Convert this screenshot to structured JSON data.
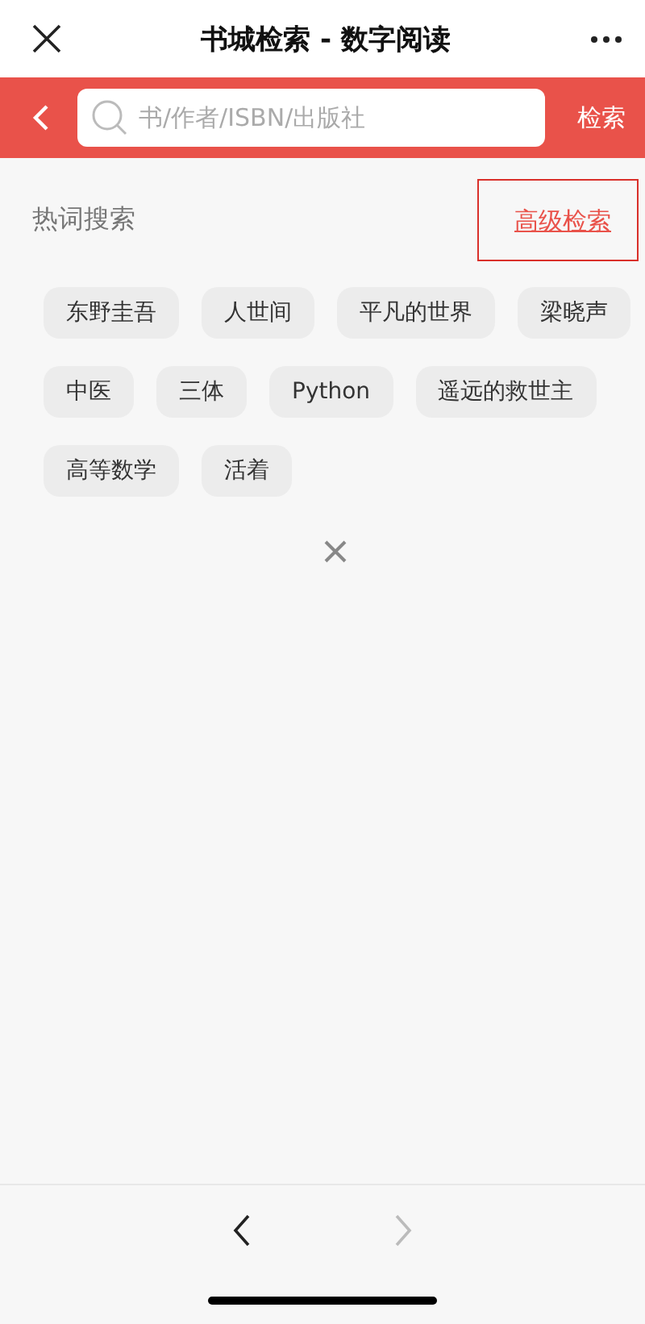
{
  "window": {
    "title": "书城检索 - 数字阅读"
  },
  "search_bar": {
    "placeholder": "书/作者/ISBN/出版社",
    "submit": "检索"
  },
  "hot_search": {
    "title": "热词搜索",
    "advanced_link": "高级检索",
    "advanced_highlighted": true,
    "tags": [
      "东野圭吾",
      "人世间",
      "平凡的世界",
      "梁晓声",
      "中医",
      "三体",
      "Python",
      "遥远的救世主",
      "高等数学",
      "活着"
    ]
  },
  "bottom_nav": {
    "back_disabled": false,
    "forward_disabled": true
  }
}
